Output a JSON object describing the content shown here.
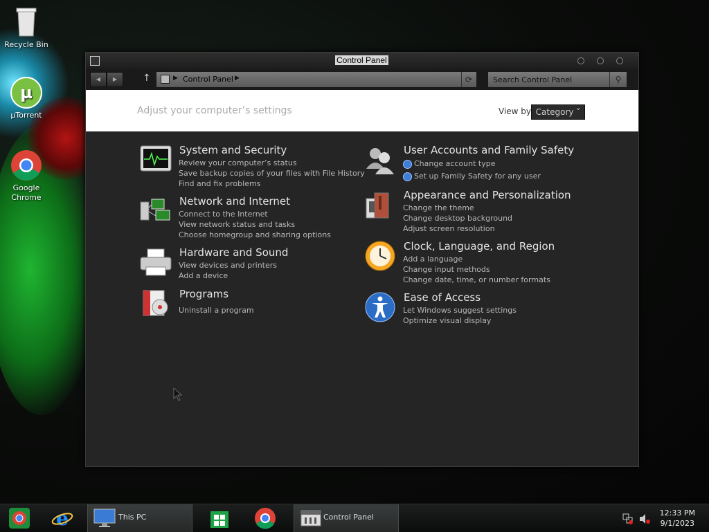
{
  "desktop": {
    "icons": [
      {
        "label": "Recycle Bin",
        "icon": "recycle-bin-icon"
      },
      {
        "label": "µTorrent",
        "icon": "utorrent-icon"
      },
      {
        "label": "Google Chrome",
        "icon": "chrome-icon"
      }
    ]
  },
  "window": {
    "title": "Control Panel",
    "address": {
      "crumb": "Control Panel"
    },
    "search": {
      "placeholder": "Search Control Panel"
    },
    "header": {
      "subtitle": "Adjust your computer’s settings",
      "view_by_label": "View by:",
      "view_by_value": "Category ˅"
    },
    "categories": [
      {
        "title": "System and Security",
        "icon": "system-security-icon",
        "links": [
          "Review your computer’s status",
          "Save backup copies of your files with File History",
          "Find and fix problems"
        ]
      },
      {
        "title": "Network and Internet",
        "icon": "network-icon",
        "links": [
          "Connect to the Internet",
          "View network status and tasks",
          "Choose homegroup and sharing options"
        ]
      },
      {
        "title": "Hardware and Sound",
        "icon": "printer-icon",
        "links": [
          "View devices and printers",
          "Add a device"
        ]
      },
      {
        "title": "Programs",
        "icon": "programs-icon",
        "links": [
          "Uninstall a program"
        ]
      },
      {
        "title": "User Accounts and Family Safety",
        "icon": "users-icon",
        "links": [
          "Change account type",
          "Set up Family Safety for any user"
        ]
      },
      {
        "title": "Appearance and Personalization",
        "icon": "appearance-icon",
        "links": [
          "Change the theme",
          "Change desktop background",
          "Adjust screen resolution"
        ]
      },
      {
        "title": "Clock, Language, and Region",
        "icon": "clock-icon",
        "links": [
          "Add a language",
          "Change input methods",
          "Change date, time, or number formats"
        ]
      },
      {
        "title": "Ease of Access",
        "icon": "ease-of-access-icon",
        "links": [
          "Let Windows suggest settings",
          "Optimize visual display"
        ]
      }
    ]
  },
  "taskbar": {
    "items": [
      {
        "label": "",
        "icon": "start-icon"
      },
      {
        "label": "",
        "icon": "internet-explorer-icon"
      },
      {
        "label": "This PC",
        "icon": "this-pc-icon"
      },
      {
        "label": "",
        "icon": "store-icon"
      },
      {
        "label": "",
        "icon": "chrome-icon"
      },
      {
        "label": "Control Panel",
        "icon": "control-panel-icon"
      }
    ],
    "clock": {
      "time": "12:33 PM",
      "date": "9/1/2023"
    }
  }
}
